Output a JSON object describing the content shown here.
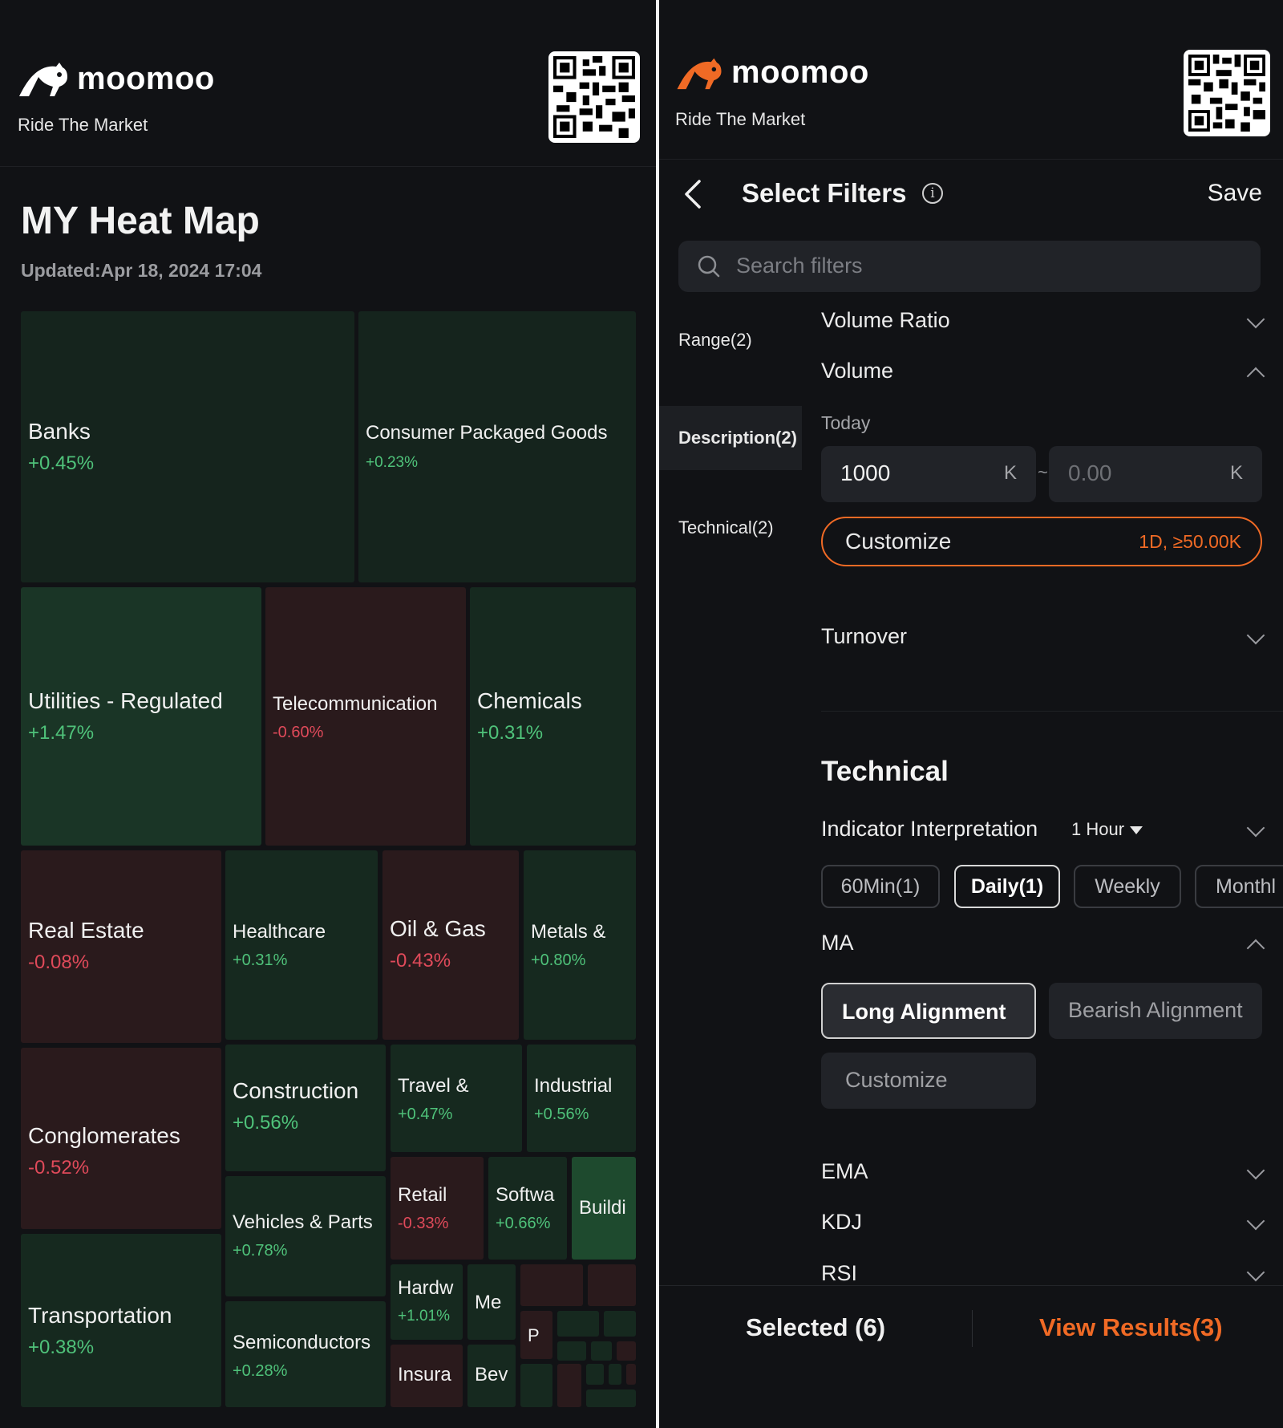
{
  "brand": {
    "name": "moomoo",
    "tagline": "Ride The Market"
  },
  "heatmap": {
    "title": "MY Heat Map",
    "updated": "Updated:Apr 18, 2024 17:04",
    "tiles": [
      {
        "name": "Banks",
        "change": "+0.45%"
      },
      {
        "name": "Consumer Packaged Goods",
        "change": "+0.23%"
      },
      {
        "name": "Utilities - Regulated",
        "change": "+1.47%"
      },
      {
        "name": "Telecommunication",
        "change": "-0.60%"
      },
      {
        "name": "Chemicals",
        "change": "+0.31%"
      },
      {
        "name": "Real Estate",
        "change": "-0.08%"
      },
      {
        "name": "Healthcare",
        "change": "+0.31%"
      },
      {
        "name": "Oil & Gas",
        "change": "-0.43%"
      },
      {
        "name": "Metals &",
        "change": "+0.80%"
      },
      {
        "name": "Conglomerates",
        "change": "-0.52%"
      },
      {
        "name": "Construction",
        "change": "+0.56%"
      },
      {
        "name": "Travel &",
        "change": "+0.47%"
      },
      {
        "name": "Industrial",
        "change": "+0.56%"
      },
      {
        "name": "Vehicles & Parts",
        "change": "+0.78%"
      },
      {
        "name": "Retail",
        "change": "-0.33%"
      },
      {
        "name": "Softwa",
        "change": "+0.66%"
      },
      {
        "name": "Buildi",
        "change": ""
      },
      {
        "name": "Transportation",
        "change": "+0.38%"
      },
      {
        "name": "Semiconductors",
        "change": "+0.28%"
      },
      {
        "name": "Hardw",
        "change": "+1.01%"
      },
      {
        "name": "Me",
        "change": ""
      },
      {
        "name": "P",
        "change": ""
      },
      {
        "name": "Insura",
        "change": ""
      },
      {
        "name": "Bev",
        "change": ""
      }
    ]
  },
  "filters": {
    "title": "Select Filters",
    "save_label": "Save",
    "search_placeholder": "Search filters",
    "sidebar": [
      {
        "label": "Range(2)"
      },
      {
        "label": "Description(2)"
      },
      {
        "label": "Technical(2)"
      }
    ],
    "volume_ratio": "Volume Ratio",
    "volume": "Volume",
    "today_label": "Today",
    "min_value": "1000",
    "max_value": "0.00",
    "unit": "K",
    "tilde": "~",
    "customize_label": "Customize",
    "customize_summary": "1D, ≥50.00K",
    "turnover": "Turnover",
    "technical_heading": "Technical",
    "indicator_label": "Indicator Interpretation",
    "indicator_period": "1 Hour",
    "periods": [
      "60Min(1)",
      "Daily(1)",
      "Weekly",
      "Monthl"
    ],
    "ma": "MA",
    "long_alignment": "Long Alignment",
    "bearish_alignment": "Bearish Alignment",
    "ma_customize": "Customize",
    "ema": "EMA",
    "kdj": "KDJ",
    "rsi": "RSI",
    "selected_label": "Selected (6)",
    "view_results_label": "View Results(3)"
  },
  "colors": {
    "accent": "#f06a25",
    "positive": "#4fc27a",
    "negative": "#e04a5a",
    "tile_green_dark": "#15241d",
    "tile_green": "#1a3526",
    "tile_red": "#2a1a1c"
  }
}
